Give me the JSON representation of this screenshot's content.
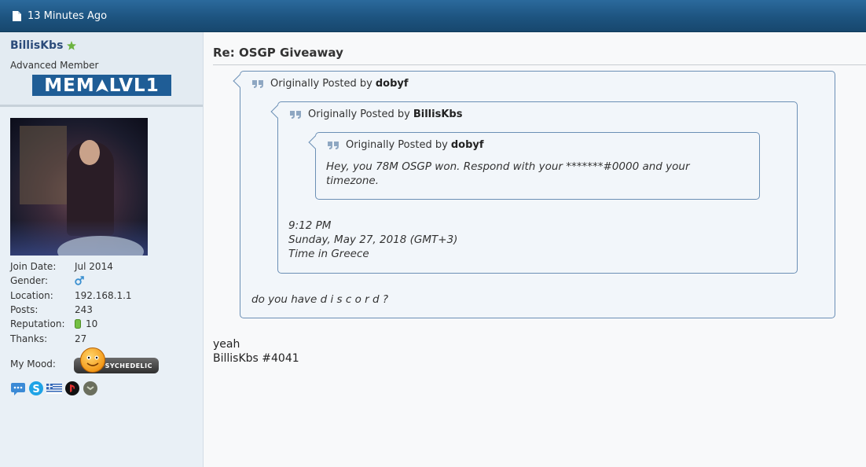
{
  "topbar": {
    "timestamp": "13 Minutes Ago",
    "icon": "document-icon"
  },
  "user": {
    "name": "BillisKbs",
    "title": "Advanced Member",
    "rank_badge": {
      "left": "MEM",
      "right": "LVL1"
    },
    "stats": [
      {
        "label": "Join Date:",
        "value": "Jul 2014"
      },
      {
        "label": "Gender:",
        "value": "",
        "icon": "male-icon"
      },
      {
        "label": "Location:",
        "value": "192.168.1.1"
      },
      {
        "label": "Posts:",
        "value": "243"
      },
      {
        "label": "Reputation:",
        "value": "10",
        "icon": "reputation-bar-icon"
      },
      {
        "label": "Thanks:",
        "value": "27"
      }
    ],
    "mood_label": "My Mood:",
    "mood_value": "PSYCHEDELIC",
    "contact_icons": [
      "im-icon",
      "skype-icon",
      "greece-flag-icon",
      "playstation-icon",
      "xbox-icon"
    ]
  },
  "post": {
    "title": "Re: OSGP Giveaway",
    "quote1": {
      "prefix": "Originally Posted by",
      "author": "dobyf",
      "text": "do you have d i s c o r d ?"
    },
    "quote2": {
      "prefix": "Originally Posted by",
      "author": "BillisKbs",
      "text_lines": [
        "9:12 PM",
        "Sunday, May 27, 2018 (GMT+3)",
        "Time in Greece"
      ]
    },
    "quote3": {
      "prefix": "Originally Posted by",
      "author": "dobyf",
      "text_lines": [
        "Hey, you 78M OSGP won. Respond with your *******#0000 and your",
        "timezone."
      ]
    },
    "reply_lines": [
      "yeah",
      "BillisKbs #4041"
    ]
  },
  "colors": {
    "topbar": "#1d5480",
    "username": "#2b4b7a",
    "quote_border": "#6b8fb5"
  }
}
